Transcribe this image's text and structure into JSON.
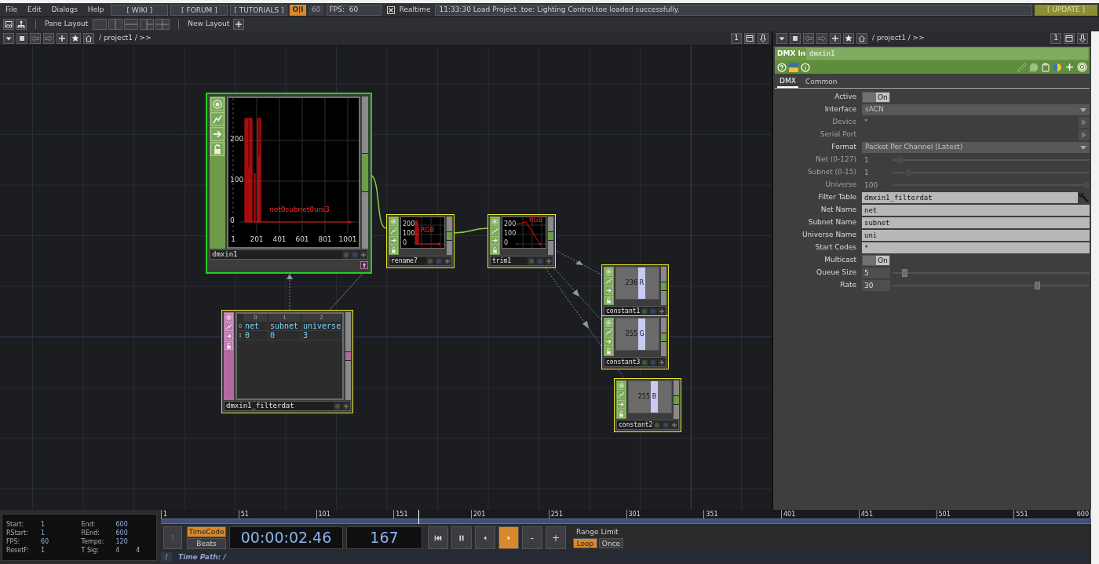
{
  "menu_bar": {
    "items": [
      "File",
      "Edit",
      "Dialogs",
      "Help"
    ],
    "links": [
      "[ WIKI ]",
      "[ FORUM ]",
      "[ TUTORIALS ]"
    ],
    "perform_button": "O|I",
    "fps_cap": "60",
    "fps": "FPS:  60",
    "realtime": {
      "label": "Realtime",
      "checked": true
    },
    "message": "11:33:30 Load Project .toe: Lighting Control.toe loaded successfully.",
    "update_button": "[ UPDATE ]"
  },
  "pane_bar": {
    "label": "Pane Layout",
    "new_layout": "New Layout"
  },
  "network": {
    "header": {
      "path": "/ project1 / >>",
      "pane_number": "1"
    },
    "nodes": [
      {
        "name": "dmxin1",
        "kind": "graph",
        "current": true,
        "y_labels": [
          "200",
          "100",
          "0"
        ],
        "x_labels": [
          "1",
          "201",
          "401",
          "601",
          "801",
          "1001"
        ],
        "channel_label": "net0subnet0uni3"
      },
      {
        "name": "rename7",
        "kind": "graph",
        "current": false,
        "y_labels": [
          "200",
          "100",
          "0"
        ],
        "channel_label": "RGB"
      },
      {
        "name": "trim1",
        "kind": "graph",
        "current": false,
        "y_labels": [
          "200",
          "100",
          "0"
        ],
        "channel_label": "RGB"
      },
      {
        "name": "dmxin1_filterdat",
        "kind": "table",
        "current": false,
        "columns": [
          "0",
          "1",
          "2"
        ],
        "rows": [
          {
            "index": "0",
            "cells": [
              "net",
              "subnet",
              "universe"
            ]
          },
          {
            "index": "1",
            "cells": [
              "0",
              "0",
              "3"
            ]
          }
        ]
      },
      {
        "name": "constant1",
        "kind": "bars",
        "current": false,
        "value": "236",
        "channel": "R"
      },
      {
        "name": "constant3",
        "kind": "bars",
        "current": false,
        "value": "255",
        "channel": "G"
      },
      {
        "name": "constant2",
        "kind": "bars",
        "current": false,
        "value": "255",
        "channel": "B"
      }
    ]
  },
  "parameters": {
    "header": {
      "path": "/ project1 / >>",
      "pane_number": "1"
    },
    "op_type": "DMX In",
    "op_name": "dmxin1",
    "tabs": [
      {
        "label": "DMX",
        "selected": true
      },
      {
        "label": "Common",
        "selected": false
      }
    ],
    "params": [
      {
        "kind": "toggle",
        "label": "Active",
        "value": "On",
        "on": true,
        "disabled": false
      },
      {
        "kind": "menu",
        "label": "Interface",
        "value": "sACN",
        "disabled": false
      },
      {
        "kind": "pulse",
        "label": "Device",
        "value": "*",
        "disabled": true
      },
      {
        "kind": "pulse",
        "label": "Serial Port",
        "disabled": true
      },
      {
        "kind": "menu",
        "label": "Format",
        "value": "Packet Per Channel (Latest)",
        "disabled": false
      },
      {
        "kind": "slider",
        "label": "Net (0-127)",
        "value": "1",
        "level": 0.02,
        "disabled": true
      },
      {
        "kind": "slider",
        "label": "Subnet (0-15)",
        "value": "1",
        "level": 0.07,
        "disabled": true
      },
      {
        "kind": "slider",
        "label": "Universe",
        "value": "100",
        "level": 1,
        "disabled": true
      },
      {
        "kind": "op_ref",
        "label": "Filter Table",
        "value": "dmxin1_filterdat",
        "disabled": false
      },
      {
        "kind": "string",
        "label": "Net Name",
        "value": "net",
        "disabled": false
      },
      {
        "kind": "string",
        "label": "Subnet Name",
        "value": "subnet",
        "disabled": false
      },
      {
        "kind": "string",
        "label": "Universe Name",
        "value": "uni",
        "disabled": false
      },
      {
        "kind": "string",
        "label": "Start Codes",
        "value": "*",
        "disabled": false
      },
      {
        "kind": "toggle",
        "label": "Multicast",
        "value": "On",
        "on": true,
        "disabled": false
      },
      {
        "kind": "slider",
        "label": "Queue Size",
        "value": "5",
        "level": 0.05,
        "disabled": false
      },
      {
        "kind": "slider",
        "label": "Rate",
        "value": "30",
        "level": 0.74,
        "disabled": false
      }
    ]
  },
  "timeline": {
    "info": [
      {
        "label": "Start:",
        "values": [
          "1"
        ]
      },
      {
        "label": "End:",
        "values": [
          "600"
        ]
      },
      {
        "label": "RStart:",
        "values": [
          "1"
        ]
      },
      {
        "label": "REnd:",
        "values": [
          "600"
        ]
      },
      {
        "label": "FPS:",
        "values": [
          "60"
        ]
      },
      {
        "label": "Tempo:",
        "values": [
          "120"
        ]
      },
      {
        "label": "ResetF:",
        "values": [
          "1"
        ]
      },
      {
        "label": "T Sig:",
        "values": [
          "4",
          "4"
        ]
      }
    ],
    "ruler": {
      "labels": [
        "1",
        "51",
        "101",
        "151",
        "201",
        "251",
        "301",
        "351",
        "401",
        "451",
        "501",
        "551",
        "600"
      ],
      "level": 0.277
    },
    "time_modes": [
      {
        "label": "TimeCode",
        "selected": true
      },
      {
        "label": "Beats",
        "selected": false
      }
    ],
    "timecode": "00:00:02.46",
    "frame": "167",
    "transport": [
      {
        "kind": "skip_start",
        "selected": false
      },
      {
        "kind": "pause",
        "selected": false
      },
      {
        "kind": "step_back",
        "selected": false
      },
      {
        "kind": "play",
        "selected": true
      },
      {
        "kind": "text",
        "label": "-",
        "selected": false
      },
      {
        "kind": "text",
        "label": "+",
        "selected": false
      }
    ],
    "range_limit": {
      "label": "Range Limit",
      "options": [
        {
          "label": "Loop",
          "selected": true
        },
        {
          "label": "Once",
          "selected": false
        }
      ]
    },
    "time_path": {
      "root": "/",
      "label": "Time Path: /"
    }
  }
}
